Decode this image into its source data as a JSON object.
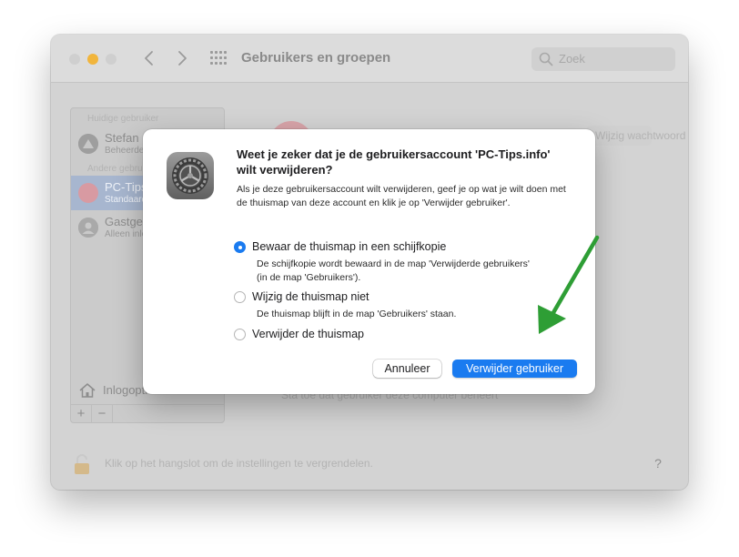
{
  "window": {
    "title": "Gebruikers en groepen",
    "search": {
      "placeholder": "Zoek",
      "icon": "search-icon"
    },
    "nav": {
      "back_icon": "chevron-left-icon",
      "forward_icon": "chevron-right-icon",
      "grid_icon": "grid-icon"
    }
  },
  "sidebar": {
    "header_current": "Huidige gebruiker",
    "header_other": "Andere gebruikers",
    "users": [
      {
        "name": "Stefan",
        "role": "Beheerder"
      },
      {
        "name": "PC-Tips",
        "role": "Standaard"
      },
      {
        "name": "Gastgebruiker",
        "role": "Alleen inloggen"
      }
    ],
    "login_options": "Inlogopties",
    "add_label": "+",
    "remove_label": "−"
  },
  "background": {
    "pill_label": "Wijzig wachtwoord of log in...",
    "allow_label": "Sta toe dat gebruiker deze computer beheert",
    "lock_label": "Klik op het hangslot om de instellingen te vergrendelen.",
    "help_label": "?"
  },
  "dialog": {
    "title": "Weet je zeker dat je de gebruikersaccount 'PC-Tips.info' wilt verwijderen?",
    "message": "Als je deze gebruikersaccount wilt verwijderen, geef je op wat je wilt doen met de thuismap van deze account en klik je op 'Verwijder gebruiker'.",
    "options": [
      {
        "label": "Bewaar de thuismap in een schijfkopie",
        "description": "De schijfkopie wordt bewaard in de map 'Verwijderde gebruikers' (in de map 'Gebruikers').",
        "selected": true
      },
      {
        "label": "Wijzig de thuismap niet",
        "description": "De thuismap blijft in de map 'Gebruikers' staan.",
        "selected": false
      },
      {
        "label": "Verwijder de thuismap",
        "description": "",
        "selected": false
      }
    ],
    "cancel_label": "Annuleer",
    "confirm_label": "Verwijder gebruiker"
  },
  "colors": {
    "accent": "#1a7bf0",
    "arrow": "#2e9e35",
    "dimmed_window": "#d3d3d3",
    "minimize_light": "#f1b53c"
  }
}
